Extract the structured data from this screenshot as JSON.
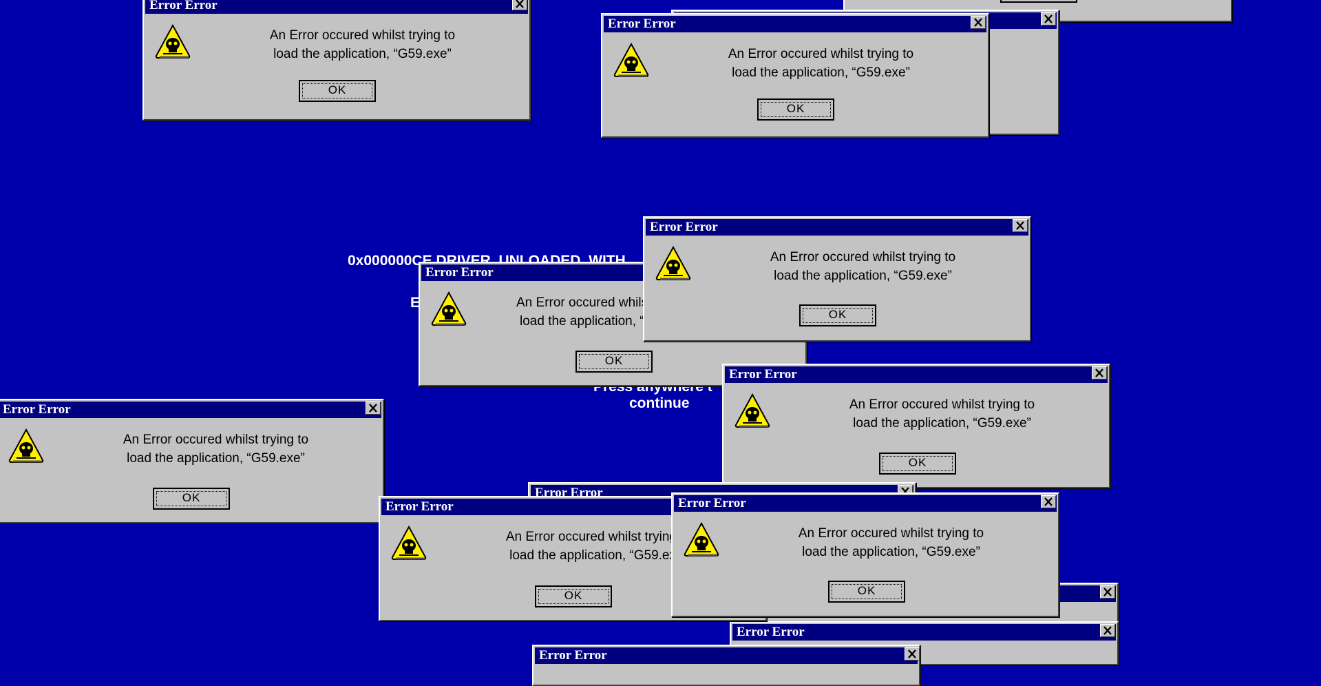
{
  "screen": {
    "background": "#0000aa",
    "stop_code": "0x000000CE DRIVER_UNLOADED_WITH",
    "stop_code_line2": "E",
    "continue_prompt": "Press anywhere t",
    "continue_prompt_line2": "continue"
  },
  "dialog": {
    "title": "Error Error",
    "message_line1": "An Error occured whilst trying to",
    "message_line2": "load the application, “G59.exe”",
    "message_line1_partial": "An Error occured whil",
    "message_line2_partial": "load the application,",
    "ok_label": "OK",
    "icon": "warning-skull-icon",
    "titlebar_color": "#000080",
    "face_color": "#c3c3c3"
  }
}
